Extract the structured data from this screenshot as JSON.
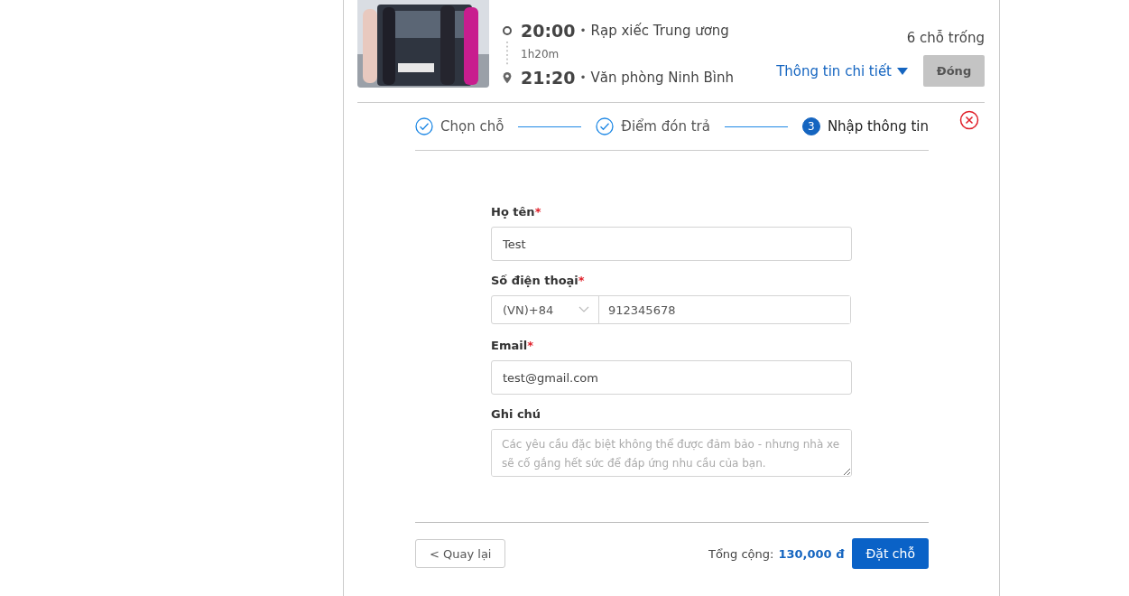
{
  "trip": {
    "departure": {
      "time": "20:00",
      "separator": "•",
      "place": "Rạp xiếc Trung ương"
    },
    "duration": "1h20m",
    "arrival": {
      "time": "21:20",
      "separator": "•",
      "place": "Văn phòng Ninh Bình"
    },
    "seats_left": "6 chỗ trống",
    "details_link": "Thông tin chi tiết",
    "close_button": "Đóng"
  },
  "steps": [
    {
      "label": "Chọn chỗ",
      "done": true,
      "selected": false
    },
    {
      "label": "Điểm đón trả",
      "done": true,
      "selected": false
    },
    {
      "label": "Nhập thông tin",
      "number": "3",
      "done": false,
      "selected": true
    }
  ],
  "form": [
    {
      "kind": "text",
      "label": "Họ tên",
      "required_mark": "*",
      "value": "Test"
    },
    {
      "kind": "phone",
      "label": "Số điện thoại",
      "required_mark": "*",
      "country_code": "(VN)+84",
      "value": "912345678"
    },
    {
      "kind": "text",
      "label": "Email",
      "required_mark": "*",
      "value": "test@gmail.com"
    },
    {
      "kind": "textarea",
      "label": "Ghi chú",
      "placeholder": "Các yêu cầu đặc biệt không thể được đảm bảo - nhưng nhà xe sẽ cố gắng hết sức để đáp ứng nhu cầu của bạn."
    }
  ],
  "footer": {
    "back_button": "< Quay lại",
    "total_label": "Tổng cộng:",
    "total_value": "130,000 đ",
    "book_button": "Đặt chỗ"
  }
}
